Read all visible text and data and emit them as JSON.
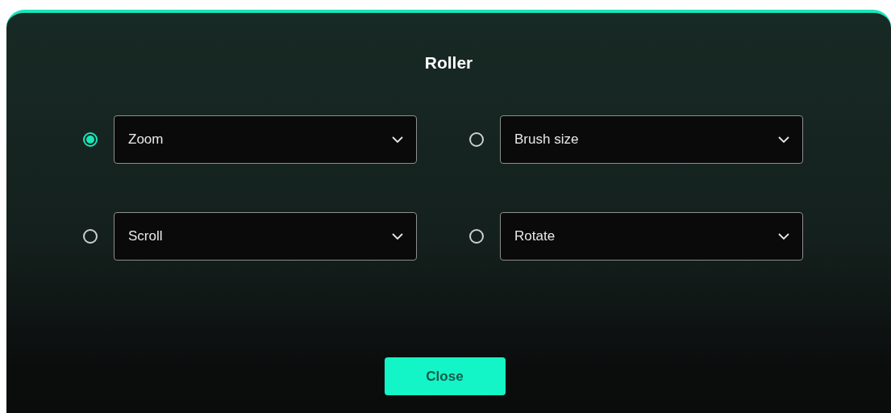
{
  "dialog": {
    "title": "Roller"
  },
  "options": [
    {
      "label": "Zoom",
      "selected": true
    },
    {
      "label": "Brush size",
      "selected": false
    },
    {
      "label": "Scroll",
      "selected": false
    },
    {
      "label": "Rotate",
      "selected": false
    }
  ],
  "buttons": [
    {
      "label": "Close"
    }
  ]
}
